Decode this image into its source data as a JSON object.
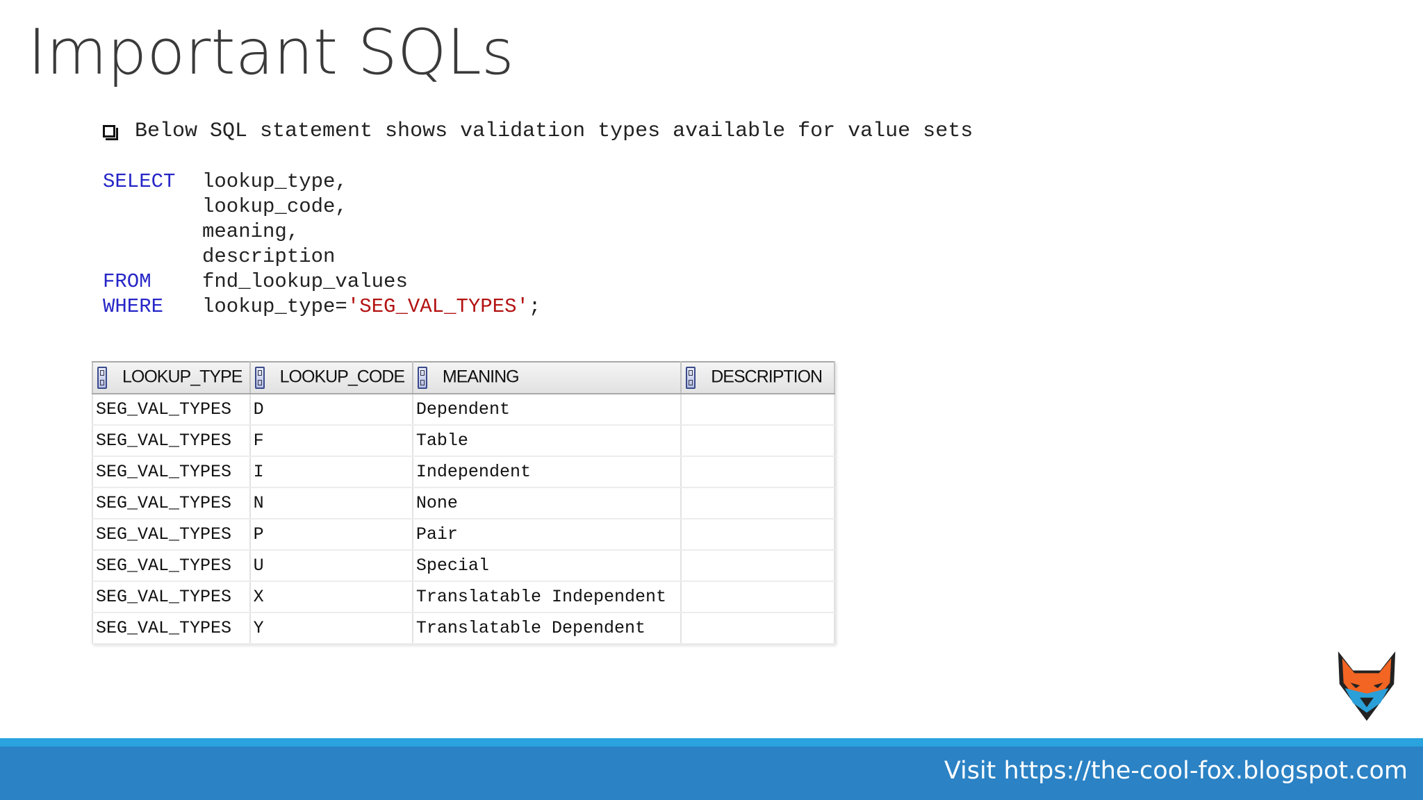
{
  "slide": {
    "title": "Important SQLs",
    "bullet": "Below SQL statement shows validation types available for value sets",
    "footer": "Visit https://the-cool-fox.blogspot.com",
    "logo_icon": "fox-head-icon"
  },
  "sql": {
    "select_kw": "SELECT",
    "col1": "lookup_type,",
    "col2": "lookup_code,",
    "col3": "meaning,",
    "col4": "description",
    "from_kw": "FROM",
    "table": "fnd_lookup_values",
    "where_kw": "WHERE",
    "where_lhs": "lookup_type=",
    "where_value": "'SEG_VAL_TYPES'",
    "terminator": ";"
  },
  "colors": {
    "keyword": "#2626c8",
    "string": "#b31212",
    "footer_bar": "#2b82c4",
    "footer_stripe": "#2aa3df"
  },
  "grid": {
    "headers": [
      "LOOKUP_TYPE",
      "LOOKUP_CODE",
      "MEANING",
      "DESCRIPTION"
    ],
    "rows": [
      [
        "SEG_VAL_TYPES",
        "D",
        "Dependent",
        ""
      ],
      [
        "SEG_VAL_TYPES",
        "F",
        "Table",
        ""
      ],
      [
        "SEG_VAL_TYPES",
        "I",
        "Independent",
        ""
      ],
      [
        "SEG_VAL_TYPES",
        "N",
        "None",
        ""
      ],
      [
        "SEG_VAL_TYPES",
        "P",
        "Pair",
        ""
      ],
      [
        "SEG_VAL_TYPES",
        "U",
        "Special",
        ""
      ],
      [
        "SEG_VAL_TYPES",
        "X",
        "Translatable Independent",
        ""
      ],
      [
        "SEG_VAL_TYPES",
        "Y",
        "Translatable Dependent",
        ""
      ]
    ]
  }
}
